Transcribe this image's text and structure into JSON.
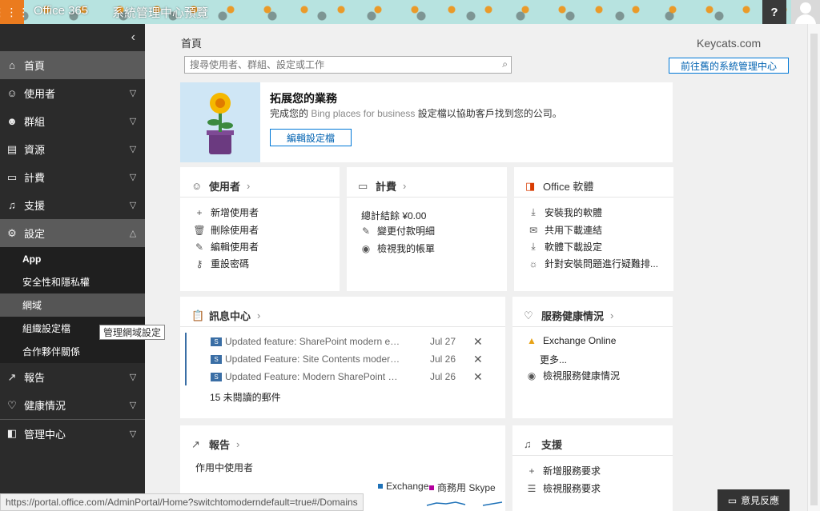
{
  "topbar": {
    "brand": "Office 365",
    "app_title": "系統管理中心預覽",
    "help_label": "?"
  },
  "sidebar": {
    "collapse_glyph": "‹",
    "items": [
      {
        "label": "首頁",
        "icon": "home-icon"
      },
      {
        "label": "使用者",
        "icon": "user-icon"
      },
      {
        "label": "群組",
        "icon": "group-icon"
      },
      {
        "label": "資源",
        "icon": "resources-icon"
      },
      {
        "label": "計費",
        "icon": "billing-icon"
      },
      {
        "label": "支援",
        "icon": "support-icon"
      },
      {
        "label": "設定",
        "icon": "settings-icon"
      },
      {
        "label": "報告",
        "icon": "reports-icon"
      },
      {
        "label": "健康情況",
        "icon": "health-icon"
      },
      {
        "label": "管理中心",
        "icon": "admin-center-icon"
      }
    ],
    "settings_sub": [
      "App",
      "安全性和隱私權",
      "網域",
      "組織設定檔",
      "合作夥伴關係"
    ],
    "tooltip": "管理網域設定"
  },
  "main": {
    "page_title": "首頁",
    "tenant": "Keycats.com",
    "search_placeholder": "搜尋使用者、群組、設定或工作",
    "old_admin_label": "前往舊的系統管理中心"
  },
  "promo": {
    "title": "拓展您的業務",
    "desc_before": "完成您的",
    "desc_grey": "Bing places for business",
    "desc_after": "設定檔以協助客戶找到您的公司。",
    "button": "編輯設定檔"
  },
  "cards": {
    "users": {
      "title": "使用者",
      "rows": [
        {
          "icon": "plus-icon",
          "label": "新增使用者"
        },
        {
          "icon": "trash-icon",
          "label": "刪除使用者"
        },
        {
          "icon": "pencil-icon",
          "label": "編輯使用者"
        },
        {
          "icon": "key-icon",
          "label": "重設密碼"
        }
      ]
    },
    "billing": {
      "title": "計費",
      "total": "總計結餘 ¥0.00",
      "rows": [
        {
          "icon": "pencil-icon",
          "label": "變更付款明細"
        },
        {
          "icon": "eye-icon",
          "label": "檢視我的帳單"
        }
      ]
    },
    "office": {
      "title": "Office 軟體",
      "rows": [
        {
          "icon": "download-icon",
          "label": "安裝我的軟體"
        },
        {
          "icon": "mail-icon",
          "label": "共用下載連結"
        },
        {
          "icon": "download-icon",
          "label": "軟體下載設定"
        },
        {
          "icon": "bulb-icon",
          "label": "針對安裝問題進行疑難排..."
        }
      ]
    },
    "messages": {
      "title": "訊息中心",
      "items": [
        {
          "text": "Updated feature: SharePoint modern exp...",
          "date": "Jul 27"
        },
        {
          "text": "Updated Feature: Site Contents modern ...",
          "date": "Jul 26"
        },
        {
          "text": "Updated Feature: Modern SharePoint Lists",
          "date": "Jul 26"
        }
      ],
      "unread_link": "15 未閱讀的郵件"
    },
    "health": {
      "title": "服務健康情況",
      "service": "Exchange Online",
      "more": "更多...",
      "view": "檢視服務健康情況"
    },
    "reports": {
      "title": "報告",
      "subtitle": "作用中使用者",
      "legend": [
        {
          "label": "Exchange",
          "color": "#1f72b8"
        },
        {
          "label": "商務用 Skype",
          "color": "#b4009e"
        }
      ]
    },
    "support": {
      "title": "支援",
      "rows": [
        {
          "icon": "plus-icon",
          "label": "新增服務要求"
        },
        {
          "icon": "list-icon",
          "label": "檢視服務要求"
        }
      ]
    }
  },
  "statusbar": {
    "url": "https://portal.office.com/AdminPortal/Home?switchtomoderndefault=true#/Domains"
  },
  "feedback": "意見反應"
}
